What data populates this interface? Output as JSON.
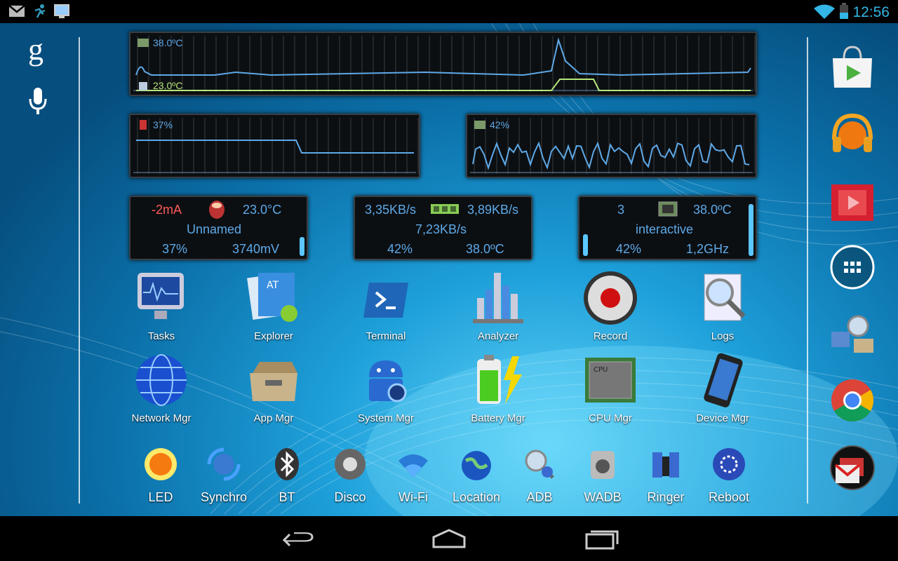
{
  "status_bar": {
    "time": "12:56",
    "icons": [
      "gmail-icon",
      "runner-icon",
      "monitor-icon",
      "wifi-icon",
      "battery-icon"
    ]
  },
  "left_column": {
    "google_search": "g",
    "voice_icon": "mic-icon"
  },
  "temp_graph": {
    "label_top": "38.0ºC",
    "label_bottom": "23.0ºC"
  },
  "battery_graph": {
    "label": "37%"
  },
  "cpu_graph": {
    "label": "42%"
  },
  "battery_widget": {
    "current": "-2mA",
    "temp": "23.0°C",
    "name": "Unnamed",
    "percent": "37%",
    "voltage": "3740mV",
    "level": 0.37
  },
  "network_widget": {
    "down": "3,35KB/s",
    "up": "3,89KB/s",
    "total": "7,23KB/s",
    "percent": "42%",
    "temp": "38.0ºC"
  },
  "cpu_widget": {
    "cores": "3",
    "temp": "38.0ºC",
    "governor": "interactive",
    "percent": "42%",
    "freq": "1,2GHz",
    "level": 0.42
  },
  "apps_row1": [
    {
      "label": "Tasks"
    },
    {
      "label": "Explorer"
    },
    {
      "label": "Terminal"
    },
    {
      "label": "Analyzer"
    },
    {
      "label": "Record"
    },
    {
      "label": "Logs"
    }
  ],
  "apps_row2": [
    {
      "label": "Network Mgr"
    },
    {
      "label": "App Mgr"
    },
    {
      "label": "System Mgr"
    },
    {
      "label": "Battery Mgr"
    },
    {
      "label": "CPU Mgr"
    },
    {
      "label": "Device Mgr"
    }
  ],
  "toolbar": [
    {
      "label": "LED"
    },
    {
      "label": "Synchro"
    },
    {
      "label": "BT"
    },
    {
      "label": "Disco"
    },
    {
      "label": "Wi-Fi"
    },
    {
      "label": "Location"
    },
    {
      "label": "ADB"
    },
    {
      "label": "WADB"
    },
    {
      "label": "Ringer"
    },
    {
      "label": "Reboot"
    }
  ],
  "dock": [
    "play-store-icon",
    "play-music-icon",
    "play-movies-icon",
    "all-apps-icon",
    "system-tuner-icon",
    "chrome-icon",
    "gmail-icon"
  ],
  "navbar": [
    "back-icon",
    "home-icon",
    "recents-icon"
  ]
}
